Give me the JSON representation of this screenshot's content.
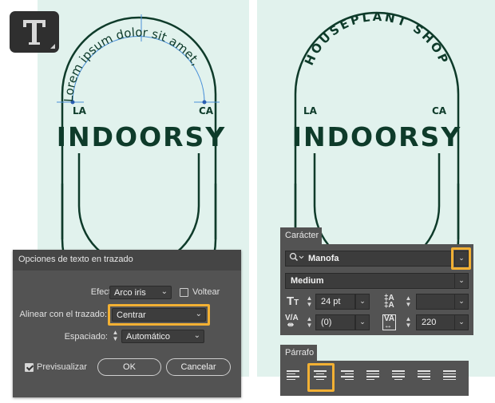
{
  "tool": {
    "icon": "type-tool-icon",
    "glyph": "T"
  },
  "artwork_left": {
    "path_text": "Lorem ipsum dolor sit amet,",
    "left_label": "LA",
    "right_label": "CA",
    "brand": "INDOORSY"
  },
  "artwork_right": {
    "path_text": "HOUSEPLANT SHOP",
    "left_label": "LA",
    "right_label": "CA",
    "brand": "INDOORSY"
  },
  "dialog": {
    "title": "Opciones de texto en trazado",
    "effect_label": "Efecto:",
    "effect_value": "Arco iris",
    "flip_label": "Voltear",
    "flip_checked": false,
    "align_label": "Alinear con el trazado:",
    "align_value": "Centrar",
    "spacing_label": "Espaciado:",
    "spacing_value": "Automático",
    "preview_label": "Previsualizar",
    "preview_checked": true,
    "ok_label": "OK",
    "cancel_label": "Cancelar"
  },
  "character_panel": {
    "tab_label": "Carácter",
    "font_family": "Manofa",
    "font_style": "Medium",
    "font_size": "24 pt",
    "leading": "",
    "kerning": "(0)",
    "tracking": "220"
  },
  "paragraph_panel": {
    "tab_label": "Párrafo",
    "alignment_buttons": [
      "align-left",
      "align-center",
      "align-right",
      "justify-left",
      "justify-center",
      "justify-right",
      "justify-all"
    ],
    "selected": "align-center"
  },
  "colors": {
    "artwork_green": "#0e3b2a",
    "canvas_bg": "#e1f2ed",
    "highlight": "#f2b033",
    "panel_bg": "#535353",
    "path_selection": "#4a90d9"
  }
}
